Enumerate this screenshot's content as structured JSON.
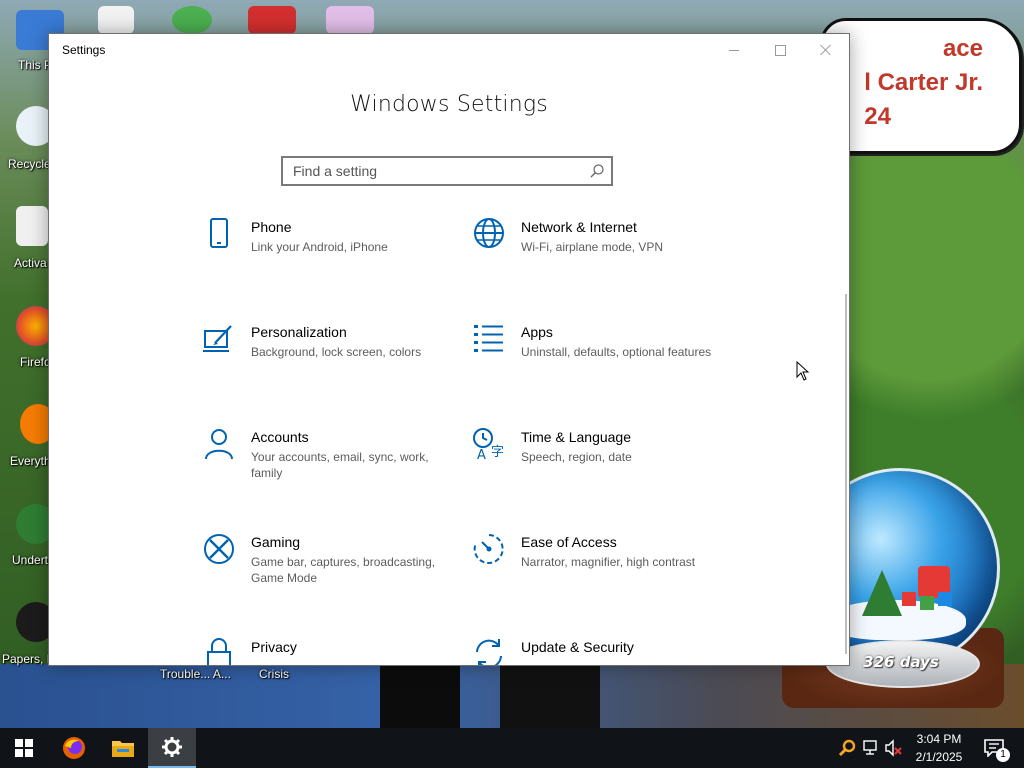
{
  "desktop": {
    "icons": [
      {
        "label": "This P"
      },
      {
        "label": "Recycle"
      },
      {
        "label": "Activa"
      },
      {
        "label": "Firefo"
      },
      {
        "label": "Everyth"
      },
      {
        "label": "Underta"
      },
      {
        "label": "Papers, P"
      }
    ],
    "bottom_labels": [
      "Trouble... A...",
      "Crisis"
    ],
    "bubble_lines": [
      "ace",
      "l Carter Jr.",
      "24"
    ],
    "globe_counter": "326 days",
    "colors": {
      "accent": "#0063b1",
      "text_secondary": "#5d5d5d"
    }
  },
  "window": {
    "title": "Settings",
    "heading": "Windows Settings",
    "search": {
      "placeholder": "Find a setting",
      "value": ""
    },
    "controls": {
      "minimize": "minimize-icon",
      "maximize": "maximize-icon",
      "close": "close-icon"
    },
    "categories": [
      {
        "title": "Phone",
        "desc": "Link your Android, iPhone",
        "icon": "phone-icon"
      },
      {
        "title": "Network & Internet",
        "desc": "Wi-Fi, airplane mode, VPN",
        "icon": "globe-icon"
      },
      {
        "title": "Personalization",
        "desc": "Background, lock screen, colors",
        "icon": "paint-icon"
      },
      {
        "title": "Apps",
        "desc": "Uninstall, defaults, optional features",
        "icon": "apps-list-icon"
      },
      {
        "title": "Accounts",
        "desc": "Your accounts, email, sync, work, family",
        "icon": "person-icon"
      },
      {
        "title": "Time & Language",
        "desc": "Speech, region, date",
        "icon": "time-language-icon"
      },
      {
        "title": "Gaming",
        "desc": "Game bar, captures, broadcasting, Game Mode",
        "icon": "xbox-icon"
      },
      {
        "title": "Ease of Access",
        "desc": "Narrator, magnifier, high contrast",
        "icon": "ease-of-access-icon"
      },
      {
        "title": "Privacy",
        "desc": "",
        "icon": "lock-icon"
      },
      {
        "title": "Update & Security",
        "desc": "",
        "icon": "sync-icon"
      }
    ]
  },
  "taskbar": {
    "start": "windows-logo-icon",
    "apps": [
      "firefox-icon",
      "file-explorer-icon",
      "settings-gear-icon"
    ],
    "tray": [
      "search-tray-icon",
      "network-icon",
      "volume-muted-icon",
      "notification-icon"
    ],
    "time": "3:04 PM",
    "date": "2/1/2025",
    "notification_count": "1"
  }
}
